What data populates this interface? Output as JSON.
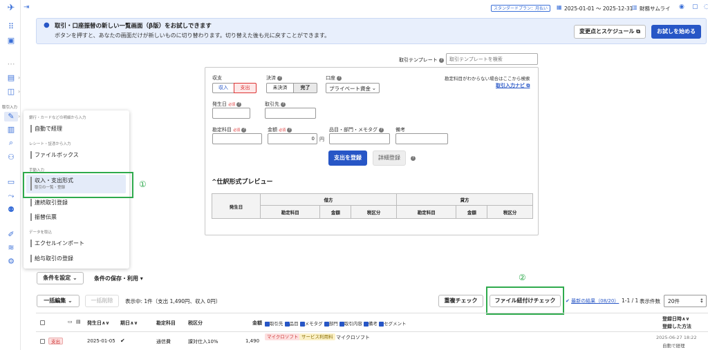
{
  "topbar": {
    "plan_badge": "スタンダードプラン：月払い",
    "period": "2025-01-01 〜 2025-12-31",
    "company": "財務サムライ"
  },
  "banner": {
    "title": "取引・口座振替の新しい一覧画面（β版）をお試しできます",
    "text": "ボタンを押すと、あなたの画面だけが新しいものに切り替わります。切り替えた後も元に戻すことができます。",
    "schedule_label": "変更点とスケジュール",
    "try_label": "お試しを始める"
  },
  "rail": {
    "section_label": "取引入力"
  },
  "template": {
    "label": "取引テンプレート",
    "placeholder": "取引テンプレートを検索"
  },
  "form": {
    "shushi_label": "収支",
    "income": "収入",
    "expense": "支出",
    "settle_label": "決済",
    "unsettled": "未決済",
    "done": "完了",
    "account_label": "口座",
    "account_value": "プライベート資金",
    "hint": "勘定科目がわからない場合はここから検索",
    "hint_link": "取引入力ナビ",
    "date_label": "発生日",
    "required": "必須",
    "partner_label": "取引先",
    "subject_label": "勘定科目",
    "amount_label": "金額",
    "amount_value": "0",
    "yen": "円",
    "item_label": "品目・部門・メモタグ",
    "note_label": "備考",
    "register": "支出を登録",
    "detail": "詳細登録"
  },
  "preview": {
    "title": "仕訳形式プレビュー",
    "date": "発生日",
    "debit": "借方",
    "credit": "貸方",
    "cols": [
      "勘定科目",
      "金額",
      "税区分",
      "勘定科目",
      "金額",
      "税区分"
    ]
  },
  "menu": {
    "sec1": "銀行・カードなどの明細から入力",
    "auto": "自動で経理",
    "sec2": "レシート・証憑から入力",
    "filebox": "ファイルボックス",
    "sec3": "手動入力",
    "shushi": "収入・支出形式",
    "shushi_sub": "取引の一覧・登録",
    "renzoku": "連続取引登録",
    "furikae": "振替伝票",
    "sec4": "データを取込",
    "excel": "エクセルインポート",
    "kyuyo": "給与取引の登録"
  },
  "annotations": {
    "one": "①",
    "two": "②"
  },
  "filters": {
    "condition": "条件を設定",
    "save": "条件の保存・利用"
  },
  "list_toolbar": {
    "bulk_edit": "一括編集",
    "bulk_delete": "一括削除",
    "count": "表示中: 1件（支出 1,490円、収入 0円）",
    "dup_check": "重複チェック",
    "file_check": "ファイル紐付けチェック",
    "latest": "最新の結果（08/20）",
    "pager": "1-1 / 1",
    "per_page_label": "表示件数",
    "per_page": "20件"
  },
  "table": {
    "headers": {
      "date": "発生日",
      "due": "期日",
      "subject": "勘定科目",
      "tax": "税区分",
      "amount": "金額",
      "partner": "取引先",
      "item": "品目",
      "memo": "メモタグ",
      "dept": "部門",
      "content": "取引内容",
      "note": "備考",
      "segment": "セグメント",
      "registered": "登録日時",
      "method": "登録した方法"
    },
    "row": {
      "type": "支出",
      "date": "2025-01-05",
      "check": "✔",
      "subject": "通信費",
      "tax": "課対仕入10%",
      "amount": "1,490",
      "partner_tag": "マイクロソフト",
      "item_tag": "サービス利用料",
      "content": "マイクロソフト",
      "registered": "2025-06-27 18:22",
      "method": "自動で経理"
    }
  },
  "colors": {
    "accent": "#2756c6",
    "highlight": "#2eaa4c",
    "expense": "#d33"
  }
}
